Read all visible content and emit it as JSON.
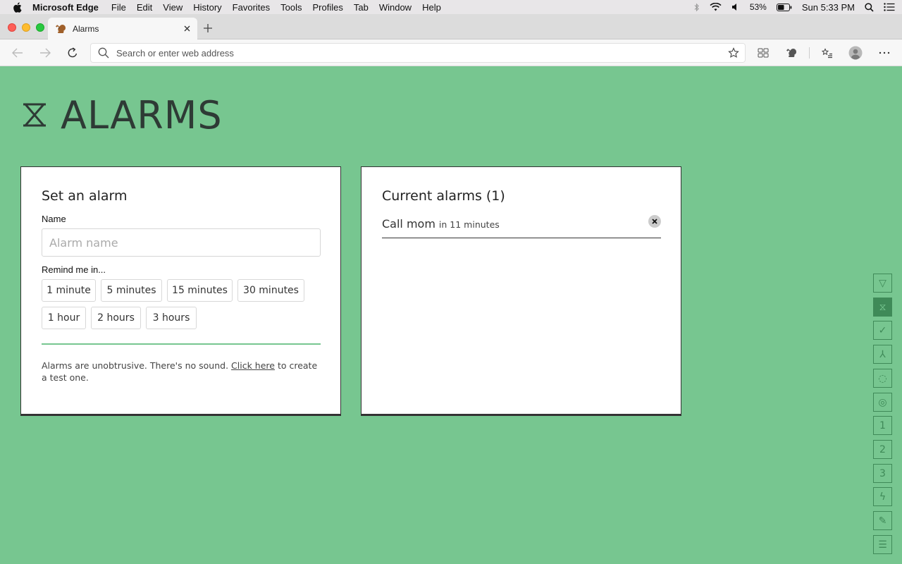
{
  "menubar": {
    "app_name": "Microsoft Edge",
    "items": [
      "File",
      "Edit",
      "View",
      "History",
      "Favorites",
      "Tools",
      "Profiles",
      "Tab",
      "Window",
      "Help"
    ],
    "battery": "53%",
    "clock": "Sun 5:33 PM"
  },
  "browser": {
    "tab_title": "Alarms",
    "address_placeholder": "Search or enter web address"
  },
  "page": {
    "title": "ALARMS",
    "set_alarm": {
      "heading": "Set an alarm",
      "name_label": "Name",
      "name_placeholder": "Alarm name",
      "name_value": "",
      "remind_label": "Remind me in...",
      "options": [
        "1 minute",
        "5 minutes",
        "15 minutes",
        "30 minutes",
        "1 hour",
        "2 hours",
        "3 hours"
      ],
      "note_prefix": "Alarms are unobtrusive. There's no sound. ",
      "note_link": "Click here",
      "note_suffix": " to create a test one."
    },
    "current": {
      "heading": "Current alarms (1)",
      "alarms": [
        {
          "name": "Call mom",
          "when": "in 11 minutes"
        }
      ]
    }
  },
  "rail": {
    "items": [
      {
        "icon": "triangle-icon",
        "label": "▽",
        "active": false
      },
      {
        "icon": "hourglass-icon",
        "label": "⧖",
        "active": true
      },
      {
        "icon": "check-icon",
        "label": "✓",
        "active": false
      },
      {
        "icon": "branch-icon",
        "label": "⅄",
        "active": false
      },
      {
        "icon": "circle-dot-icon",
        "label": "◌",
        "active": false
      },
      {
        "icon": "target-icon",
        "label": "◎",
        "active": false
      },
      {
        "icon": "digit-one-icon",
        "label": "1",
        "active": false
      },
      {
        "icon": "digit-two-icon",
        "label": "2",
        "active": false
      },
      {
        "icon": "digit-three-icon",
        "label": "3",
        "active": false
      },
      {
        "icon": "lightning-icon",
        "label": "ϟ",
        "active": false
      },
      {
        "icon": "pencil-icon",
        "label": "✎",
        "active": false
      },
      {
        "icon": "menu-icon",
        "label": "☰",
        "active": false
      }
    ]
  }
}
